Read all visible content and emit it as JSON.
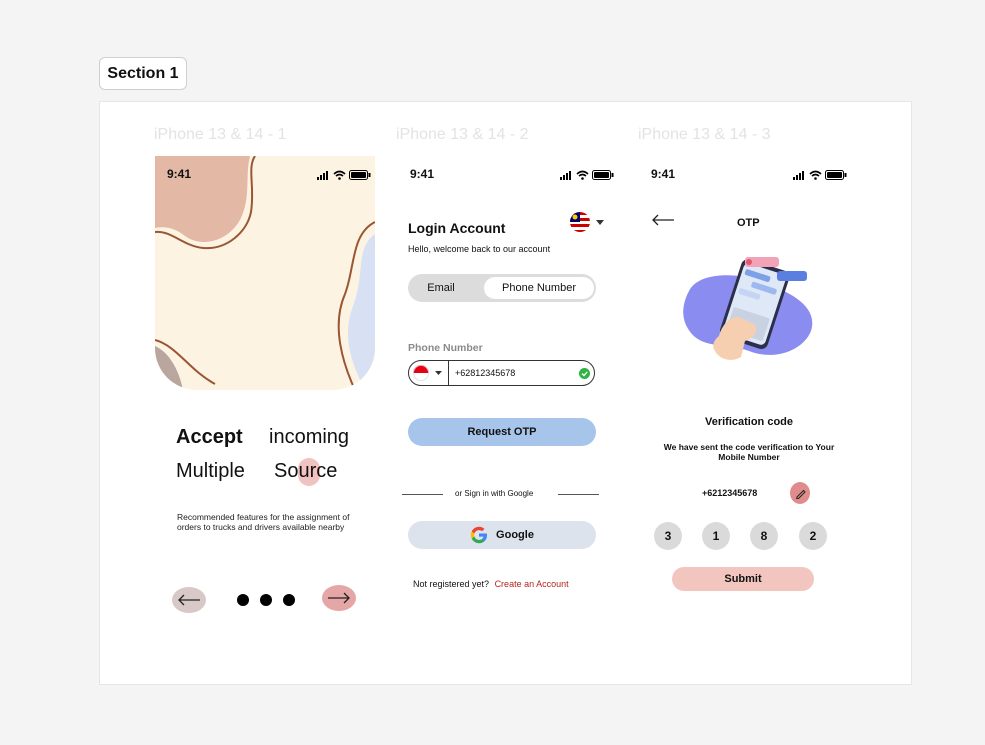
{
  "section": {
    "label": "Section 1"
  },
  "frames": [
    {
      "label": "iPhone 13 & 14 - 1"
    },
    {
      "label": "iPhone 13 & 14 - 2"
    },
    {
      "label": "iPhone 13 & 14 - 3"
    }
  ],
  "status_bar": {
    "time": "9:41"
  },
  "onboarding": {
    "title_word_1": "Accept",
    "title_word_2": "incoming",
    "title_word_3": "Multiple",
    "title_word_4": "Source",
    "description": "Recommended features for the assignment of orders to trucks and drivers available nearby",
    "colors": {
      "cream": "#fdf3e3",
      "terracotta": "#e3b8a5",
      "brown_line": "#9a5632",
      "blue_blob": "#d8e0f3",
      "accent_pink": "#e4a6a6",
      "back_button": "#d9c8c8"
    }
  },
  "login": {
    "heading": "Login Account",
    "subheading": "Hello, welcome back to our account",
    "tab_email": "Email",
    "tab_phone": "Phone Number",
    "phone_label": "Phone Number",
    "phone_value": "+62812345678",
    "request_otp_label": "Request OTP",
    "divider_text": "or Sign in with Google",
    "google_label": "Google",
    "not_registered": "Not registered yet?",
    "create_account": "Create an Account",
    "colors": {
      "otp_button": "#a7c4ea",
      "google_button": "#dde3ec",
      "link": "#b3261e",
      "check": "#2fb344"
    }
  },
  "otp": {
    "title": "OTP",
    "heading": "Verification code",
    "message": "We have sent the code verification to Your Mobile Number",
    "phone_value": "+6212345678",
    "digits": [
      "3",
      "1",
      "8",
      "2"
    ],
    "submit_label": "Submit",
    "colors": {
      "submit": "#f3c5bf",
      "edit": "#e08c8c",
      "illustration_blob": "#8a8cf0"
    }
  }
}
